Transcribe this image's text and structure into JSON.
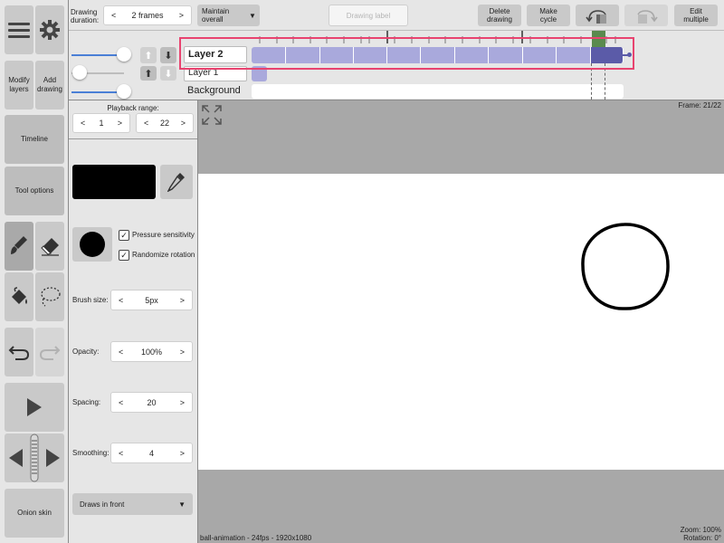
{
  "toolbar": {
    "drawing_duration_label": "Drawing duration:",
    "duration_value": "2 frames",
    "maintain_label": "Maintain overall",
    "drawing_label_placeholder": "Drawing label",
    "delete_drawing": "Delete drawing",
    "make_cycle": "Make cycle",
    "edit_multiple": "Edit multiple"
  },
  "layers": [
    {
      "name": "Layer 2"
    },
    {
      "name": "Layer 1"
    },
    {
      "name": "Background"
    }
  ],
  "left_tools": {
    "modify_layers": "Modify layers",
    "add_drawing": "Add drawing",
    "timeline": "Timeline",
    "tool_options": "Tool options",
    "onion_skin": "Onion skin"
  },
  "options": {
    "playback_range_label": "Playback range:",
    "playback_start": "1",
    "playback_end": "22",
    "pressure_sensitivity": "Pressure sensitivity",
    "randomize_rotation": "Randomize rotation",
    "brush_size_label": "Brush size:",
    "brush_size_value": "5px",
    "opacity_label": "Opacity:",
    "opacity_value": "100%",
    "spacing_label": "Spacing:",
    "spacing_value": "20",
    "smoothing_label": "Smoothing:",
    "smoothing_value": "4",
    "draws_in_front": "Draws in front",
    "color_swatch": "#000000"
  },
  "canvas": {
    "frame_readout": "Frame: 21/22",
    "info": "ball-animation - 24fps - 1920x1080",
    "zoom": "Zoom: 100%",
    "rotation": "Rotation: 0°"
  },
  "colors": {
    "highlight": "#e8436f",
    "frame_fill": "#a9a9dc",
    "frame_selected": "#5b5ba8",
    "playhead": "#5a8a4e"
  }
}
